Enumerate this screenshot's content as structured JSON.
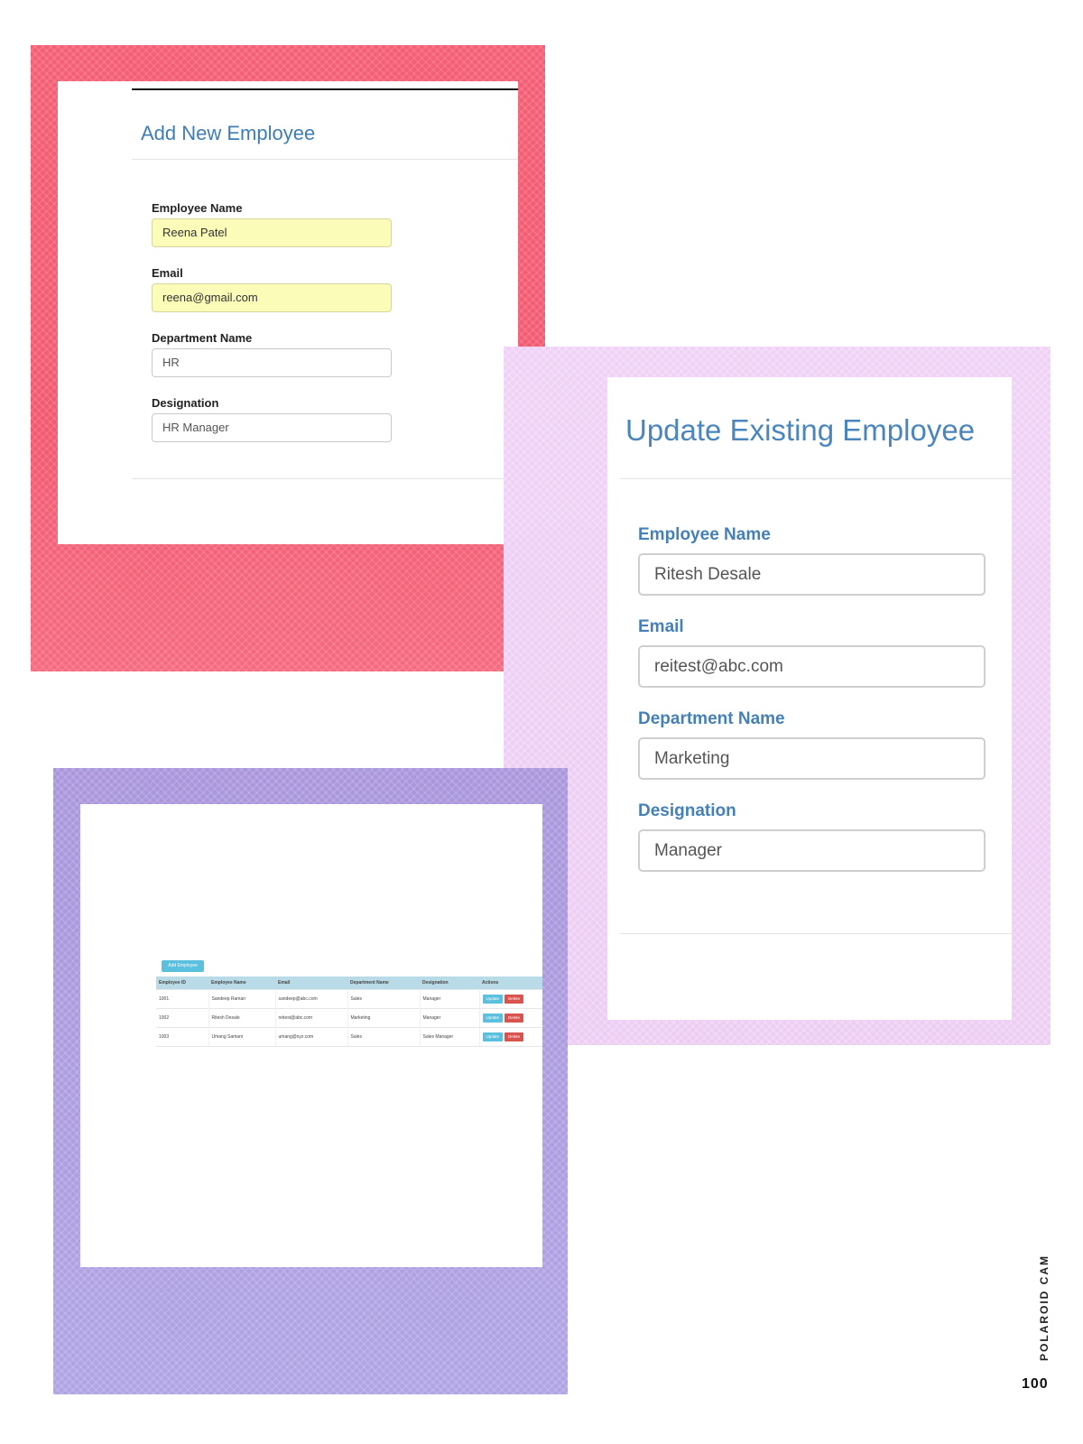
{
  "add_form": {
    "title": "Add New Employee",
    "fields": [
      {
        "label": "Employee Name",
        "value": "Reena Patel"
      },
      {
        "label": "Email",
        "value": "reena@gmail.com"
      },
      {
        "label": "Department Name",
        "value": "HR"
      },
      {
        "label": "Designation",
        "value": "HR Manager"
      }
    ]
  },
  "update_form": {
    "title": "Update Existing Employee",
    "fields": [
      {
        "label": "Employee Name",
        "value": "Ritesh Desale"
      },
      {
        "label": "Email",
        "value": "reitest@abc.com"
      },
      {
        "label": "Department Name",
        "value": "Marketing"
      },
      {
        "label": "Designation",
        "value": "Manager"
      }
    ]
  },
  "employee_table": {
    "add_button_label": "Add Employee",
    "columns": [
      "Employee ID",
      "Employee Name",
      "Email",
      "Department Name",
      "Designation",
      "Actions"
    ],
    "rows": [
      {
        "id": "1001",
        "name": "Sandeep Raman",
        "email": "sandeep@abc.com",
        "department": "Sales",
        "designation": "Manager"
      },
      {
        "id": "1002",
        "name": "Ritesh Desale",
        "email": "reitest@abc.com",
        "department": "Marketing",
        "designation": "Manager"
      },
      {
        "id": "1003",
        "name": "Umang Samani",
        "email": "umang@xyz.com",
        "department": "Sales",
        "designation": "Sales Manager"
      }
    ],
    "update_label": "Update",
    "delete_label": "Delete"
  },
  "page_label": "POLAROID CAM",
  "page_number": "100",
  "colors": {
    "frame_red": "#f45f75",
    "frame_pink": "#efd0f5",
    "frame_purple": "#ab9ade",
    "title_blue": "#3f7db4",
    "highlight_yellow": "#fafcb8",
    "table_header": "#b8dbe7",
    "button_info": "#5bc0de",
    "button_danger": "#d9534f"
  }
}
